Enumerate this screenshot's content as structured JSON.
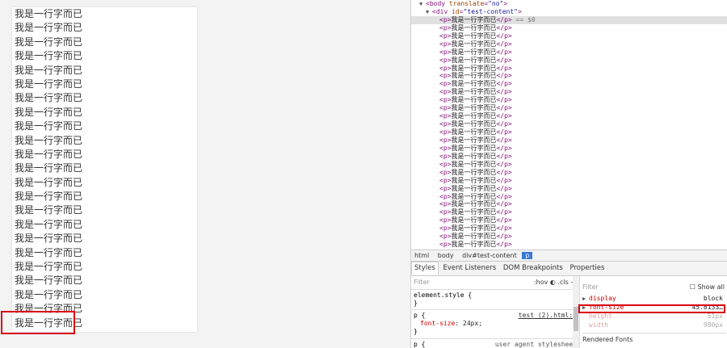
{
  "content": {
    "line_text": "我是一行字而已",
    "line_count": 24
  },
  "dom_tree": {
    "body_line": {
      "tag": "body",
      "attr": "translate",
      "val": "\"no\""
    },
    "div_line": {
      "tag": "div",
      "attr": "id",
      "val": "\"test-content\""
    },
    "p_text": "我是一行字而已",
    "selected_marker": "== $0",
    "p_count": 29
  },
  "breadcrumbs": [
    "html",
    "body",
    "div#test-content",
    "p"
  ],
  "tabs": [
    "Styles",
    "Event Listeners",
    "DOM Breakpoints",
    "Properties"
  ],
  "styles": {
    "filter_placeholder": "Filter",
    "hov": ":hov",
    "cls": ".cls",
    "plus": "+",
    "element_style": "element.style {",
    "close": "}",
    "rule1_selector": "p {",
    "rule1_source": "test (2).html:8",
    "rule1_prop": "font-size",
    "rule1_value": "24px;",
    "rule2_selector": "p {",
    "rule2_source": "user agent stylesheet"
  },
  "computed": {
    "filter_placeholder": "Filter",
    "show_all": "Show all",
    "rows": [
      {
        "name": "display",
        "value": "block",
        "dim": false,
        "tri": true
      },
      {
        "name": "font-size",
        "value": "45.8133…",
        "dim": false,
        "tri": true
      },
      {
        "name": "height",
        "value": "51px",
        "dim": true,
        "tri": false
      },
      {
        "name": "width",
        "value": "980px",
        "dim": true,
        "tri": false
      }
    ],
    "rendered_fonts": "Rendered Fonts"
  },
  "colors": {
    "highlight_red": "#d9000d",
    "tag_purple": "#881280",
    "breadcrumb_active": "#3879d9"
  }
}
